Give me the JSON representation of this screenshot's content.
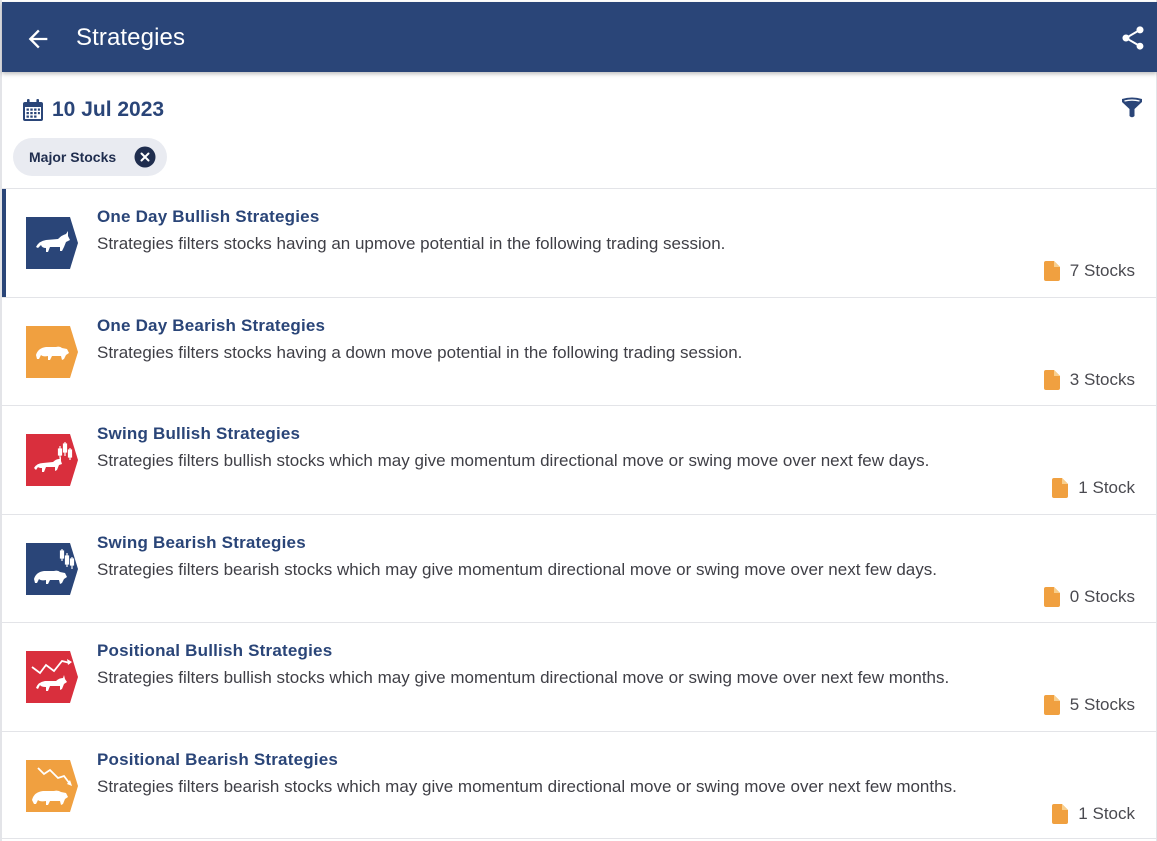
{
  "header": {
    "title": "Strategies",
    "back_icon": "arrow-left-icon",
    "share_icon": "share-icon",
    "bg_color": "#2a4578"
  },
  "toolbar": {
    "date": "10 Jul 2023",
    "calendar_icon": "calendar-icon",
    "filter_icon": "filter-icon"
  },
  "filters": {
    "chip_label": "Major Stocks",
    "chip_close_icon": "close-circle-icon"
  },
  "colors": {
    "navy": "#2a4578",
    "orange": "#f0a040",
    "red": "#d92f3d"
  },
  "strategies": [
    {
      "title": "One Day Bullish Strategies",
      "description": "Strategies filters stocks having an upmove potential in the following trading session.",
      "count": "7 Stocks",
      "icon": "bull-icon",
      "icon_color": "#2a4578",
      "active": true
    },
    {
      "title": "One Day Bearish Strategies",
      "description": "Strategies filters stocks having a down move potential in the following trading session.",
      "count": "3 Stocks",
      "icon": "bear-icon",
      "icon_color": "#f0a040",
      "active": false
    },
    {
      "title": "Swing Bullish Strategies",
      "description": "Strategies filters bullish stocks which may give momentum directional move or swing move over next few days.",
      "count": "1 Stock",
      "icon": "bull-candlestick-icon",
      "icon_color": "#d92f3d",
      "active": false
    },
    {
      "title": "Swing Bearish Strategies",
      "description": "Strategies filters bearish stocks which may give momentum directional move or swing move over next few days.",
      "count": "0 Stocks",
      "icon": "bear-candlestick-icon",
      "icon_color": "#2a4578",
      "active": false
    },
    {
      "title": "Positional Bullish Strategies",
      "description": "Strategies filters bullish stocks which may give momentum directional move or swing move over next few months.",
      "count": "5 Stocks",
      "icon": "bull-uptrend-icon",
      "icon_color": "#d92f3d",
      "active": false
    },
    {
      "title": "Positional Bearish Strategies",
      "description": "Strategies filters bearish stocks which may give momentum directional move or swing move over next few months.",
      "count": "1 Stock",
      "icon": "bear-downtrend-icon",
      "icon_color": "#f0a040",
      "active": false
    }
  ]
}
